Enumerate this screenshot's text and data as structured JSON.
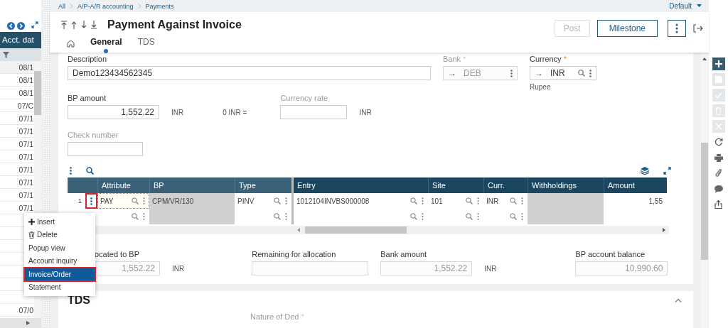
{
  "breadcrumb": [
    "All",
    "A/P-A/R accounting",
    "Payments"
  ],
  "profile": "Default",
  "left_panel": {
    "column": "Acct. dat",
    "rows": [
      "08/1",
      "08/1",
      "08/1",
      "07/C",
      "07/1",
      "07/1",
      "07/1",
      "07/1",
      "07/1",
      "07/1",
      "07/1",
      "07/1"
    ],
    "tail_rows": [
      "07/0"
    ]
  },
  "title": "Payment Against Invoice",
  "buttons": [
    {
      "label": "Post",
      "disabled": true
    },
    {
      "label": "Milestone",
      "disabled": false
    }
  ],
  "tabs": [
    {
      "label": "General",
      "selected": true
    },
    {
      "label": "TDS",
      "selected": false
    }
  ],
  "description": {
    "label": "Description",
    "value": "Demo123434562345"
  },
  "bank": {
    "label": "Bank",
    "star": "*",
    "disabled": true,
    "prefix": "→",
    "value": "DEB"
  },
  "currency": {
    "label": "Currency",
    "star": "*",
    "disabled": false,
    "prefix": "→",
    "value": "INR",
    "caption": "Rupee"
  },
  "bp_amount": {
    "label": "BP amount",
    "value": "1,552.22",
    "unit": "INR"
  },
  "rate_prefix": "0 INR =",
  "currency_rate": {
    "label": "Currency rate",
    "disabled": true,
    "unit": "INR"
  },
  "check_number": {
    "label": "Check number",
    "disabled": true
  },
  "grid": {
    "columns": [
      {
        "label": "Attribute",
        "lookup": true,
        "disabled": false
      },
      {
        "label": "BP",
        "lookup": false,
        "disabled": true
      },
      {
        "label": "Type",
        "lookup": true,
        "disabled": false
      },
      {
        "label": "Entry",
        "lookup": true,
        "disabled": false
      },
      {
        "label": "Site",
        "lookup": true,
        "disabled": false
      },
      {
        "label": "Curr.",
        "lookup": true,
        "disabled": false
      },
      {
        "label": "Withholdings",
        "lookup": false,
        "disabled": true
      },
      {
        "label": "Amount",
        "lookup": false,
        "disabled": false
      }
    ],
    "rows": [
      {
        "number": "1",
        "highlighted": true,
        "cells": [
          "PAY",
          "CPM/VR/130",
          "PINV",
          "1012104INVBS000008",
          "101",
          "INR",
          "",
          "1,55"
        ]
      }
    ]
  },
  "context_menu": [
    {
      "label": "Insert",
      "kind": "insert",
      "selected": false
    },
    {
      "label": "Delete",
      "kind": "delete",
      "selected": false
    },
    {
      "label": "Popup view",
      "kind": "plain",
      "selected": false
    },
    {
      "label": "Account inquiry",
      "kind": "plain",
      "selected": false
    },
    {
      "label": "Invoice/Order",
      "kind": "plain",
      "selected": true
    },
    {
      "label": "Statement",
      "kind": "plain",
      "selected": false
    }
  ],
  "totals": [
    {
      "label": "ocated to BP",
      "value": "1,552.22",
      "unit": "INR",
      "disabled": true
    },
    {
      "label": "Remaining for allocation",
      "disabled": true
    },
    {
      "label": "Bank amount",
      "value": "1,552.22",
      "unit": "INR",
      "disabled": true
    },
    {
      "label": "BP account balance",
      "value": "10,990.60",
      "disabled": true
    }
  ],
  "tds": {
    "title": "TDS",
    "field_label": "Nature of Ded",
    "star": "*",
    "expanded": true
  },
  "toolbar": [
    {
      "kind": "plus",
      "disabled": false
    },
    {
      "kind": "save",
      "disabled": true
    },
    {
      "kind": "check",
      "disabled": true
    },
    {
      "kind": "trash",
      "disabled": true
    },
    {
      "kind": "close",
      "disabled": true
    },
    {
      "kind": "refresh",
      "disabled": false
    },
    {
      "kind": "print",
      "disabled": false
    },
    {
      "kind": "clip",
      "disabled": false
    },
    {
      "kind": "comment",
      "disabled": false
    },
    {
      "kind": "share",
      "disabled": false
    }
  ]
}
